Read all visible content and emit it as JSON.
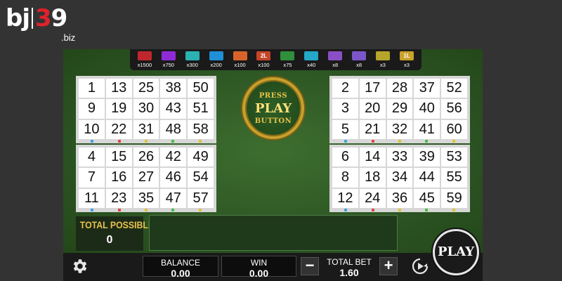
{
  "logo": {
    "brand_a": "bj",
    "brand_b": "3",
    "brand_c": "9",
    "tld": ".biz"
  },
  "paytable": [
    {
      "icon": "",
      "color": "#c0272d",
      "label": "x1500"
    },
    {
      "icon": "",
      "color": "#8e2bd6",
      "label": "x750"
    },
    {
      "icon": "",
      "color": "#2bb1b3",
      "label": "x300"
    },
    {
      "icon": "",
      "color": "#1f8fd8",
      "label": "x200"
    },
    {
      "icon": "",
      "color": "#d8632a",
      "label": "x100"
    },
    {
      "icon": "2L",
      "color": "#c6452a",
      "label": "x100"
    },
    {
      "icon": "",
      "color": "#2f8f3a",
      "label": "x75"
    },
    {
      "icon": "",
      "color": "#25a7c7",
      "label": "x40"
    },
    {
      "icon": "",
      "color": "#8a4fc6",
      "label": "x8"
    },
    {
      "icon": "",
      "color": "#7a56c9",
      "label": "x8"
    },
    {
      "icon": "",
      "color": "#b5a52a",
      "label": "x3"
    },
    {
      "icon": "1L",
      "color": "#c9a12b",
      "label": "x3"
    }
  ],
  "cards": [
    {
      "rows": [
        [
          "1",
          "13",
          "25",
          "38",
          "50"
        ],
        [
          "9",
          "19",
          "30",
          "43",
          "51"
        ],
        [
          "10",
          "22",
          "31",
          "48",
          "58"
        ]
      ],
      "dots": [
        "#3aa0e0",
        "#e04040",
        "#e0c030",
        "#40c040",
        "#e0c030"
      ]
    },
    {
      "rows": [
        [
          "2",
          "17",
          "28",
          "37",
          "52"
        ],
        [
          "3",
          "20",
          "29",
          "40",
          "56"
        ],
        [
          "5",
          "21",
          "32",
          "41",
          "60"
        ]
      ],
      "dots": [
        "#3aa0e0",
        "#e04040",
        "#e0c030",
        "#40c040",
        "#e0c030"
      ]
    },
    {
      "rows": [
        [
          "4",
          "15",
          "26",
          "42",
          "49"
        ],
        [
          "7",
          "16",
          "27",
          "46",
          "54"
        ],
        [
          "11",
          "23",
          "35",
          "47",
          "57"
        ]
      ],
      "dots": [
        "#3aa0e0",
        "#e04040",
        "#e0c030",
        "#40c040",
        "#e0c030"
      ]
    },
    {
      "rows": [
        [
          "6",
          "14",
          "33",
          "39",
          "53"
        ],
        [
          "8",
          "18",
          "34",
          "44",
          "55"
        ],
        [
          "12",
          "24",
          "36",
          "45",
          "59"
        ]
      ],
      "dots": [
        "#3aa0e0",
        "#e04040",
        "#e0c030",
        "#40c040",
        "#e0c030"
      ]
    }
  ],
  "medallion": {
    "press": "PRESS",
    "play": "PLAY",
    "button": "BUTTON"
  },
  "total_possible": {
    "label": "TOTAL POSSIBLE",
    "value": "0"
  },
  "bottom": {
    "balance_label": "BALANCE",
    "balance_value": "0.00",
    "win_label": "WIN",
    "win_value": "0.00",
    "bet_label": "TOTAL BET",
    "bet_value": "1.60",
    "minus": "−",
    "plus": "+"
  },
  "play_button": "PLAY",
  "icons": {
    "settings": "gear-icon",
    "autoplay": "autoplay-icon"
  },
  "colors": {
    "felt": "#2e5a24",
    "gold": "#e8c24a",
    "bar": "#1a1a1a"
  }
}
